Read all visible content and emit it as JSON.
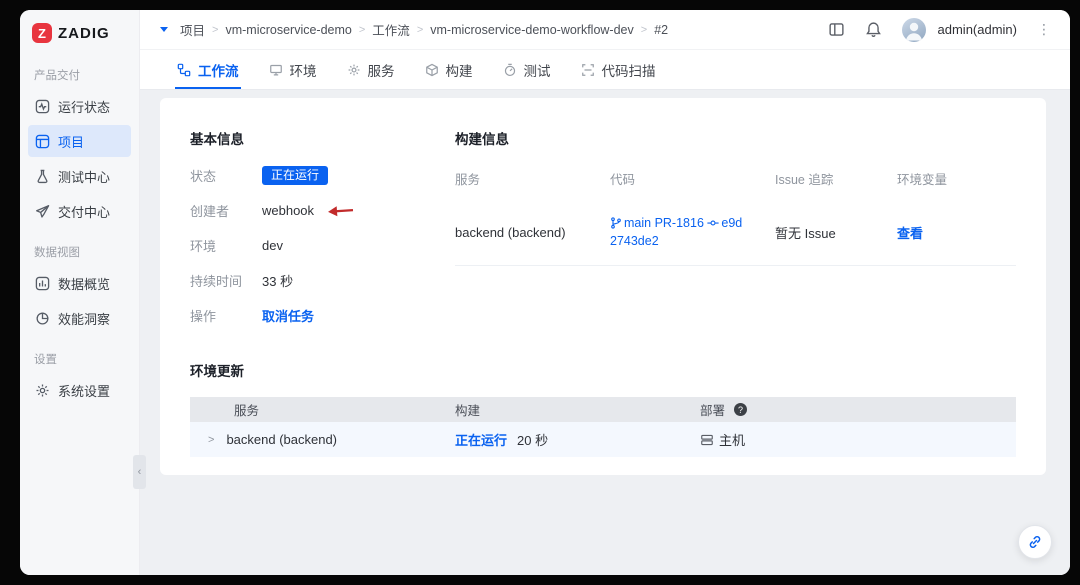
{
  "brand": {
    "name": "ZADIG"
  },
  "sidebar": {
    "section1": "产品交付",
    "section2": "数据视图",
    "section3": "设置",
    "items": {
      "run_status": "运行状态",
      "projects": "项目",
      "test_center": "测试中心",
      "delivery_center": "交付中心",
      "data_overview": "数据概览",
      "insight": "效能洞察",
      "system_settings": "系统设置"
    }
  },
  "topbar": {
    "breadcrumb": [
      "项目",
      "vm-microservice-demo",
      "工作流",
      "vm-microservice-demo-workflow-dev",
      "#2"
    ],
    "user": "admin(admin)"
  },
  "tabs": {
    "workflow": "工作流",
    "env": "环境",
    "service": "服务",
    "build": "构建",
    "test": "测试",
    "scan": "代码扫描"
  },
  "basic": {
    "title": "基本信息",
    "status_label": "状态",
    "status_value": "正在运行",
    "creator_label": "创建者",
    "creator_value": "webhook",
    "env_label": "环境",
    "env_value": "dev",
    "duration_label": "持续时间",
    "duration_value": "33 秒",
    "action_label": "操作",
    "action_value": "取消任务"
  },
  "build": {
    "title": "构建信息",
    "col_service": "服务",
    "col_code": "代码",
    "col_issue": "Issue 追踪",
    "col_envvar": "环境变量",
    "row": {
      "service": "backend (backend)",
      "branch": "main PR-1816",
      "commit": "e9d2743de2",
      "issue": "暂无 Issue",
      "action": "查看"
    }
  },
  "envupdate": {
    "title": "环境更新",
    "col_service": "服务",
    "col_build": "构建",
    "col_deploy": "部署",
    "row": {
      "service": "backend (backend)",
      "build_status": "正在运行",
      "build_duration": "20 秒",
      "deploy": "主机"
    }
  },
  "ui": {
    "crumb_sep": ">",
    "more": "⋮",
    "collapse": "‹",
    "expand": ">",
    "help": "?",
    "logo_letter": "Z"
  },
  "icons": {
    "logo": "zadig-red-badge",
    "sidebar": [
      "pulse-icon",
      "project-icon",
      "flask-icon",
      "plane-icon",
      "bar-chart-icon",
      "pie-chart-icon",
      "gear-icon"
    ],
    "tabs": [
      "workflow-icon",
      "monitor-icon",
      "gear-icon",
      "cube-icon",
      "gauge-icon",
      "scan-icon"
    ],
    "topbar": [
      "panel-icon",
      "bell-icon",
      "avatar",
      "more-icon"
    ],
    "inline": [
      "git-branch-icon",
      "git-commit-icon",
      "host-icon",
      "link-icon",
      "red-arrow",
      "help-icon"
    ]
  },
  "colors": {
    "accent": "#0a62f0",
    "badge_bg": "#0a62f0",
    "sidebar_active_bg": "#dde8fb",
    "content_bg": "#eef0f3",
    "table_head_bg": "#e6e8ec",
    "table_row_bg": "#f4f8fe",
    "annotation_red": "#c22b2b",
    "logo_red": "#e8353f"
  }
}
